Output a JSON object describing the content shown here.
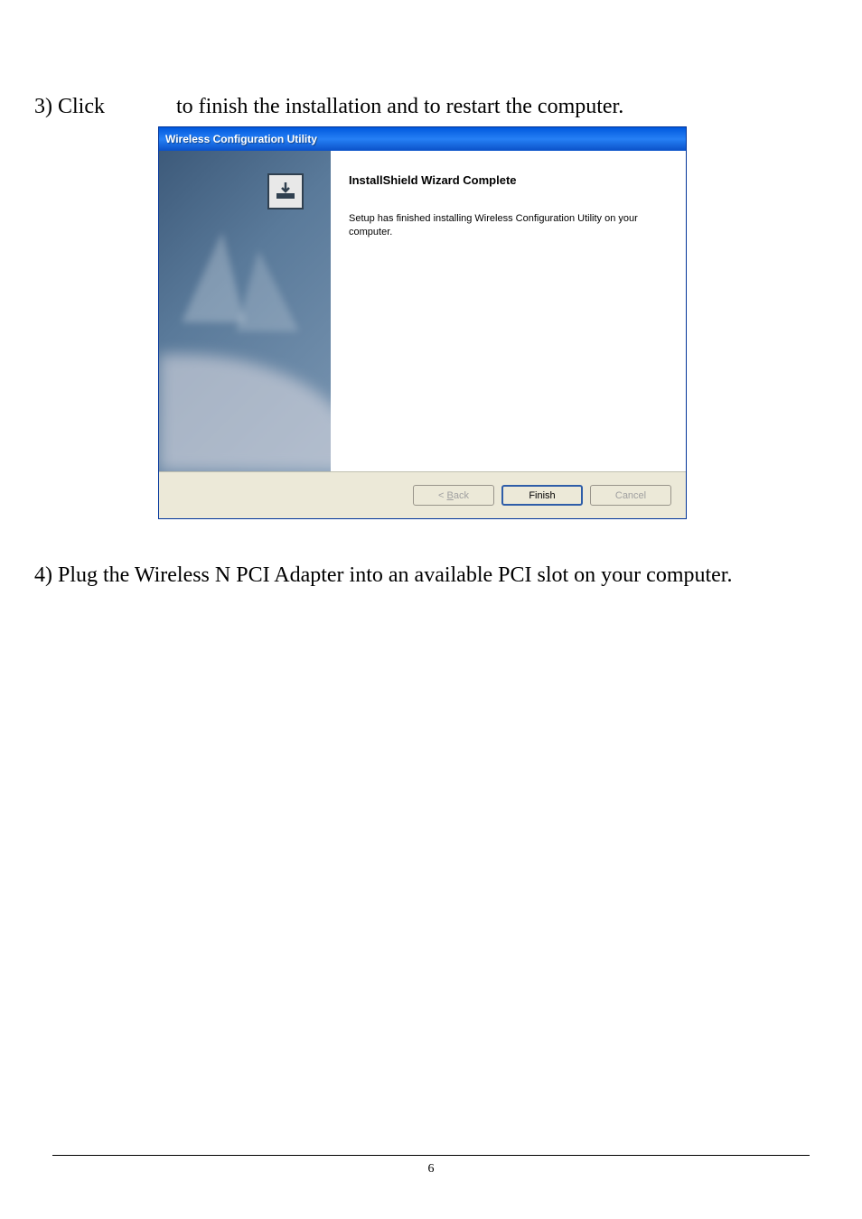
{
  "document": {
    "step3_part1": "3) Click",
    "step3_part2": "to finish the installation and to restart the computer.",
    "step4": "4) Plug the Wireless N PCI Adapter into an available PCI slot on your computer.",
    "page_number": "6"
  },
  "dialog": {
    "title": "Wireless Configuration Utility",
    "heading": "InstallShield Wizard Complete",
    "description": "Setup has finished installing Wireless Configuration Utility on your computer.",
    "buttons": {
      "back": "< Back",
      "back_letter": "B",
      "finish": "Finish",
      "cancel": "Cancel"
    }
  }
}
